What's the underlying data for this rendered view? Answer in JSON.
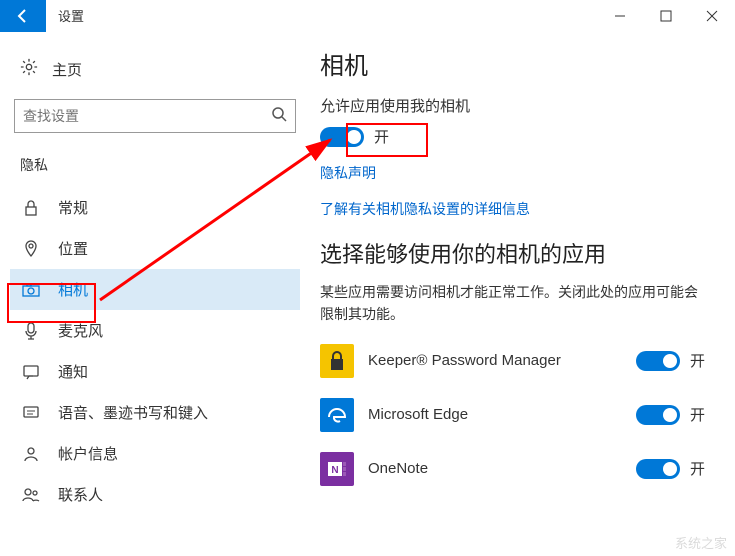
{
  "titlebar": {
    "title": "设置"
  },
  "sidebar": {
    "home": "主页",
    "search_placeholder": "查找设置",
    "group": "隐私",
    "items": [
      {
        "label": "常规"
      },
      {
        "label": "位置"
      },
      {
        "label": "相机"
      },
      {
        "label": "麦克风"
      },
      {
        "label": "通知"
      },
      {
        "label": "语音、墨迹书写和键入"
      },
      {
        "label": "帐户信息"
      },
      {
        "label": "联系人"
      }
    ]
  },
  "main": {
    "title": "相机",
    "toggle_caption": "允许应用使用我的相机",
    "toggle_state": "开",
    "privacy_link": "隐私声明",
    "learn_link": "了解有关相机隐私设置的详细信息",
    "sub_title": "选择能够使用你的相机的应用",
    "sub_desc": "某些应用需要访问相机才能正常工作。关闭此处的应用可能会限制其功能。",
    "apps": [
      {
        "name": "Keeper® Password Manager",
        "state": "开",
        "color": "#f5c400"
      },
      {
        "name": "Microsoft Edge",
        "state": "开",
        "color": "#0078d7"
      },
      {
        "name": "OneNote",
        "state": "开",
        "color": "#7b2fa1"
      }
    ]
  },
  "watermark": "系统之家"
}
